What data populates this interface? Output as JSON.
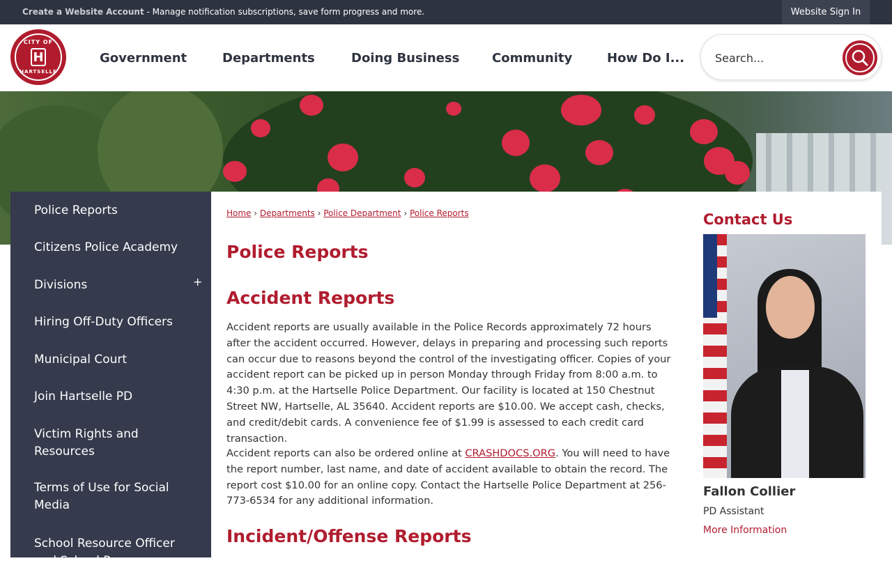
{
  "topbar": {
    "create_account": "Create a Website Account",
    "message": " - Manage notification subscriptions, save form progress and more.",
    "sign_in": "Website Sign In"
  },
  "logo": {
    "line1": "CITY OF",
    "line2": "HARTSELLE",
    "letter": "H"
  },
  "nav": [
    "Government",
    "Departments",
    "Doing Business",
    "Community",
    "How Do I..."
  ],
  "search": {
    "placeholder": "Search..."
  },
  "sidebar": {
    "items": [
      "Police Reports",
      "Citizens Police Academy",
      "Divisions",
      "Hiring Off-Duty Officers",
      "Municipal Court",
      "Join Hartselle PD",
      "Victim Rights and Resources",
      "Terms of Use for Social Media",
      "School Resource Officer and School Resource"
    ],
    "expand_symbol": "+"
  },
  "breadcrumb": [
    "Home",
    "Departments",
    "Police Department",
    "Police Reports"
  ],
  "breadcrumb_sep": "›",
  "page": {
    "title": "Police Reports",
    "accident_heading": "Accident Reports",
    "accident_p1": "Accident reports are usually available in the Police Records approximately 72 hours after the accident occurred. However, delays in preparing and processing such reports can occur due to reasons beyond the control of the investigating officer.  Copies of your accident report can be picked up in person Monday through Friday from 8:00 a.m. to 4:30 p.m.  at the Hartselle Police Department. Our facility is located at 150 Chestnut Street NW, Hartselle, AL 35640.  Accident reports are $10.00. We accept cash, checks, and credit/debit cards. A convenience fee of $1.99 is assessed to each credit card transaction.",
    "accident_p2_before": "Accident reports can also be ordered online at ",
    "accident_p2_link": "CRASHDOCS.ORG",
    "accident_p2_after": ". You will need to have the report number, last name, and date of accident available to obtain the record. The report cost $10.00 for an online copy. Contact the Hartselle Police Department at 256-773-6534 for any additional information.",
    "incident_heading": "Incident/Offense Reports"
  },
  "contact": {
    "title": "Contact Us",
    "name": "Fallon Collier",
    "role": "PD Assistant",
    "more": "More Information"
  },
  "colors": {
    "brand_red": "#b01c2e",
    "dark_navy": "#2e3340",
    "sidebar": "#353a4c"
  }
}
